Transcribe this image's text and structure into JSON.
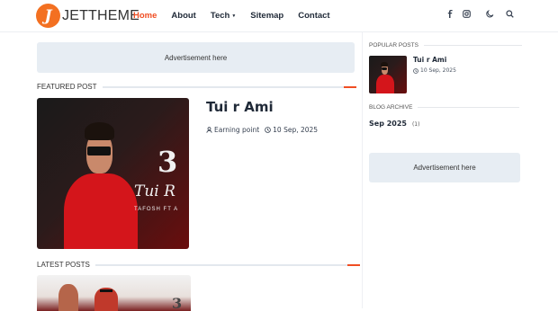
{
  "brand": {
    "logo_letter": "J",
    "name": "JETTHEME",
    "accent": "#f37021"
  },
  "nav": [
    {
      "label": "Home",
      "active": true
    },
    {
      "label": "About"
    },
    {
      "label": "Tech",
      "has_dropdown": true
    },
    {
      "label": "Sitemap"
    },
    {
      "label": "Contact"
    }
  ],
  "header_icons": [
    "facebook-icon",
    "instagram-icon",
    "moon-icon",
    "search-icon"
  ],
  "ads": {
    "top": "Advertisement here",
    "sidebar": "Advertisement here"
  },
  "featured": {
    "section_title": "FEATURED POST",
    "title": "Tui r Ami",
    "author": "Earning point",
    "date": "10 Sep, 2025",
    "poster_big_number": "3",
    "poster_script": "Tui R",
    "poster_credit": "TAFOSH FT A"
  },
  "latest": {
    "section_title": "LATEST POSTS"
  },
  "sidebar": {
    "popular_title": "POPULAR POSTS",
    "popular_post_title": "Tui r Ami",
    "popular_post_date": "10 Sep, 2025",
    "archive_title": "BLOG ARCHIVE",
    "archive_month": "Sep 2025",
    "archive_count": "(1)"
  },
  "colors": {
    "accent": "#f04e23",
    "ad_bg": "#e7edf3"
  }
}
